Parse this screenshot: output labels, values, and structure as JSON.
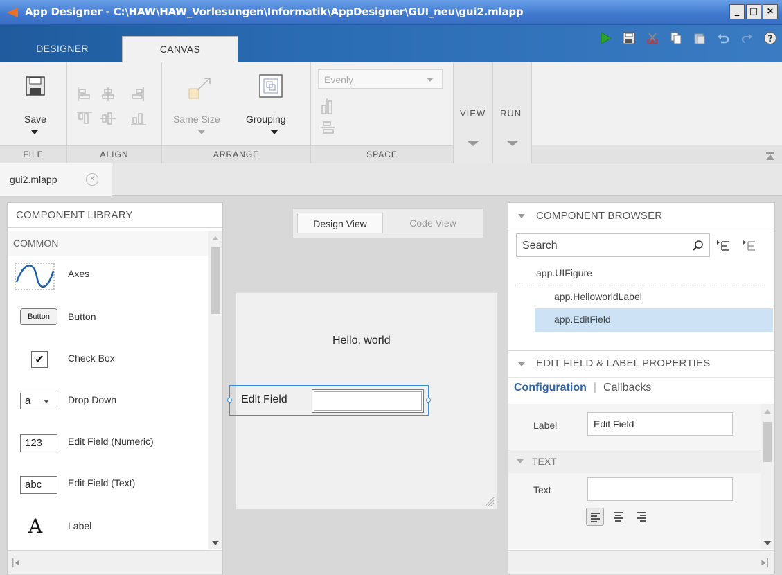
{
  "window": {
    "title": "App Designer - C:\\HAW\\HAW_Vorlesungen\\Informatik\\AppDesigner\\GUI_neu\\gui2.mlapp",
    "minimize": "_",
    "maximize": "□",
    "close": "×"
  },
  "tabs": {
    "designer": "DESIGNER",
    "canvas": "CANVAS"
  },
  "ribbon": {
    "file": {
      "save_label": "Save",
      "group_label": "FILE"
    },
    "align": {
      "group_label": "ALIGN"
    },
    "arrange": {
      "same_size_label": "Same Size",
      "grouping_label": "Grouping",
      "group_label": "ARRANGE"
    },
    "space": {
      "dropdown_value": "Evenly",
      "group_label": "SPACE"
    },
    "view": {
      "label": "VIEW"
    },
    "run": {
      "label": "RUN"
    }
  },
  "document_tab": {
    "name": "gui2.mlapp",
    "close": "×"
  },
  "component_library": {
    "title": "COMPONENT LIBRARY",
    "section": "COMMON",
    "items": [
      {
        "label": "Axes",
        "icon": "axes-icon"
      },
      {
        "label": "Button",
        "icon": "button-icon",
        "icon_text": "Button"
      },
      {
        "label": "Check Box",
        "icon": "checkbox-icon",
        "icon_text": "✔"
      },
      {
        "label": "Drop Down",
        "icon": "dropdown-icon",
        "icon_text": "a"
      },
      {
        "label": "Edit Field (Numeric)",
        "icon": "numeric-field-icon",
        "icon_text": "123"
      },
      {
        "label": "Edit Field (Text)",
        "icon": "text-field-icon",
        "icon_text": "abc"
      },
      {
        "label": "Label",
        "icon": "label-icon",
        "icon_text": "A"
      }
    ],
    "footer_icon": "|◂"
  },
  "view_toggle": {
    "design": "Design View",
    "code": "Code View"
  },
  "canvas": {
    "hello_label": "Hello, world",
    "edit_field_label": "Edit Field",
    "edit_field_value": ""
  },
  "component_browser": {
    "title": "COMPONENT BROWSER",
    "search_placeholder": "Search",
    "tree": [
      "app.UIFigure",
      "app.HelloworldLabel",
      "app.EditField"
    ],
    "selected": "app.EditField"
  },
  "properties": {
    "title": "EDIT FIELD & LABEL PROPERTIES",
    "tab_active": "Configuration",
    "tab_separator": "|",
    "tab_other": "Callbacks",
    "label_field_label": "Label",
    "label_field_value": "Edit Field",
    "text_section": "TEXT",
    "text_field_label": "Text",
    "text_field_value": "",
    "footer_icon": "▸|"
  },
  "colors": {
    "title_bar": "#3f78cf",
    "tab_strip": "#2a6cb4",
    "selection": "#cde3f5",
    "accent": "#2f64a8",
    "run_green": "#2aa52a"
  }
}
